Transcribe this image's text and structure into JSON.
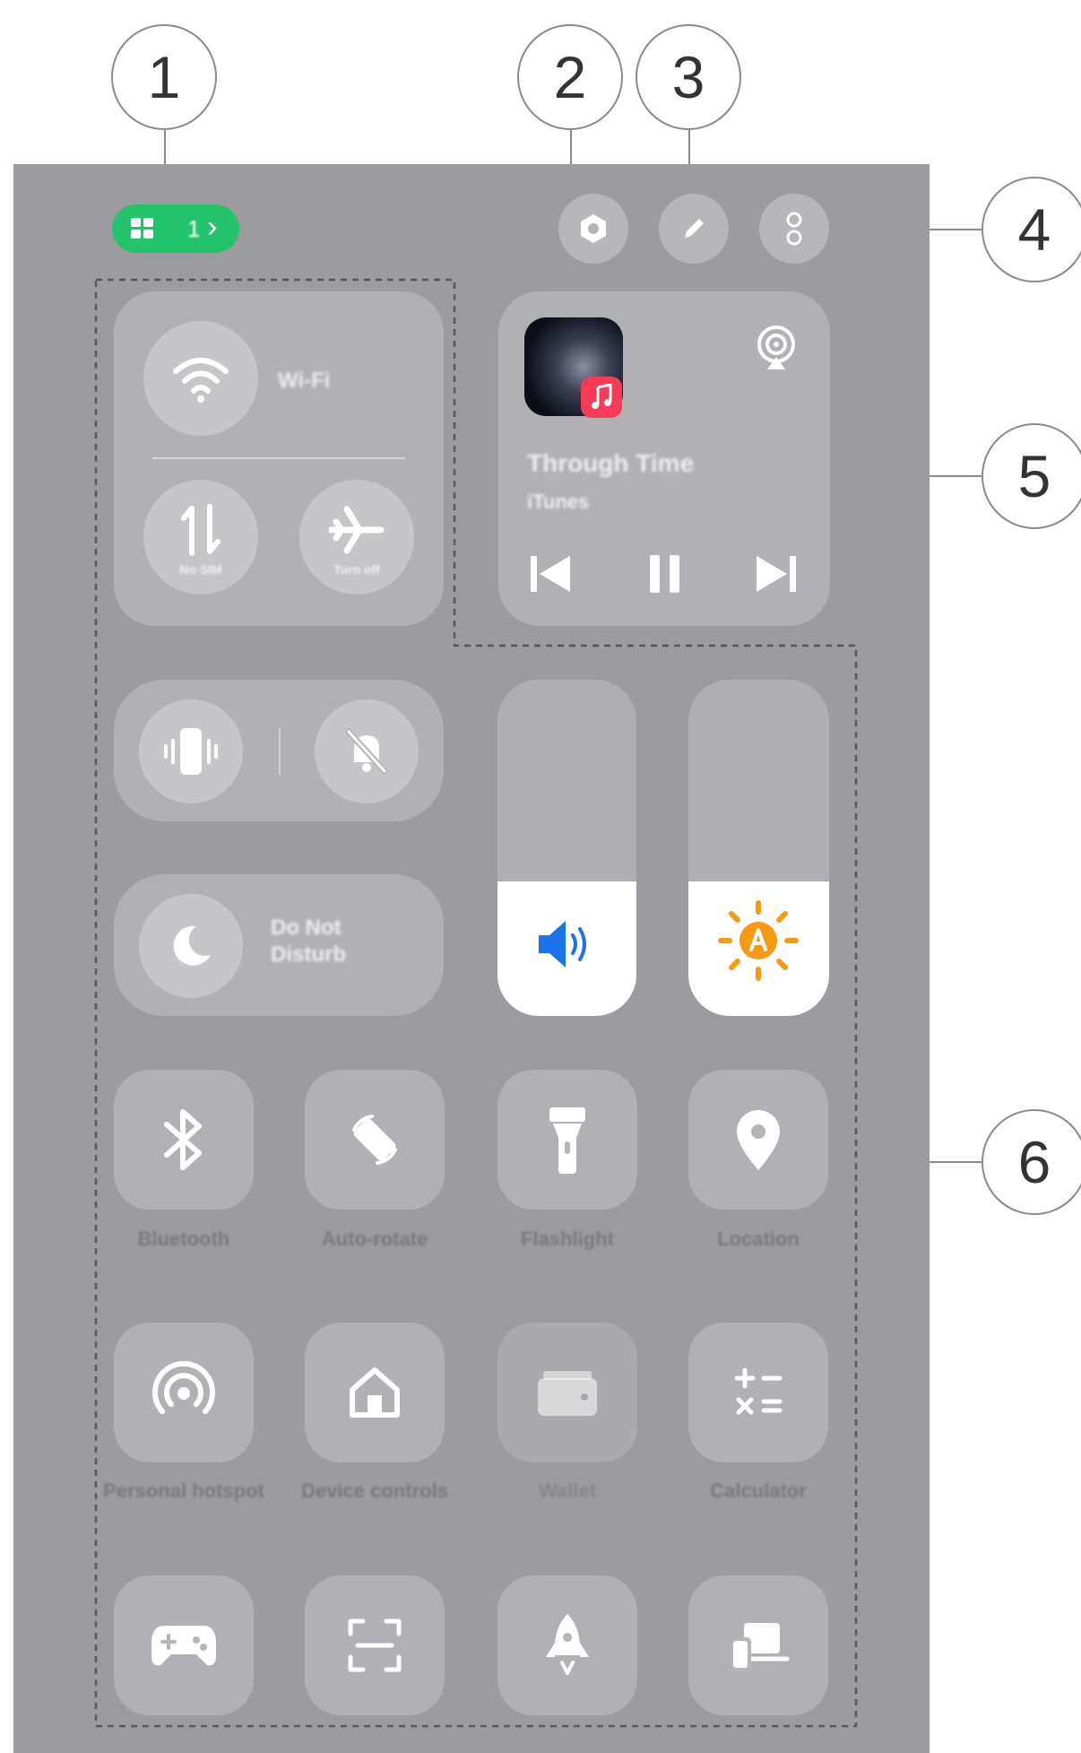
{
  "callouts": [
    "1",
    "2",
    "3",
    "4",
    "5",
    "6"
  ],
  "status_pill": {
    "count": "1",
    "chevron": "›"
  },
  "connectivity": {
    "wifi_label": "Wi-Fi",
    "mobile_data_label": "No SIM",
    "airplane_label": "Turn off"
  },
  "media": {
    "title": "Through Time",
    "artist": "iTunes"
  },
  "focus": {
    "dnd_label": "Do Not Disturb"
  },
  "sliders": {
    "volume_level": 0.4,
    "brightness_level": 0.4
  },
  "quick_tiles": [
    {
      "label": "Bluetooth"
    },
    {
      "label": "Auto-rotate"
    },
    {
      "label": "Flashlight"
    },
    {
      "label": "Location"
    },
    {
      "label": "Personal hotspot"
    },
    {
      "label": "Device controls"
    },
    {
      "label": "Wallet"
    },
    {
      "label": "Calculator"
    }
  ],
  "colors": {
    "accent_green": "#22c36b",
    "volume_blue": "#1a73e8",
    "brightness_orange": "#f59a12",
    "music_red": "#f53b57"
  }
}
